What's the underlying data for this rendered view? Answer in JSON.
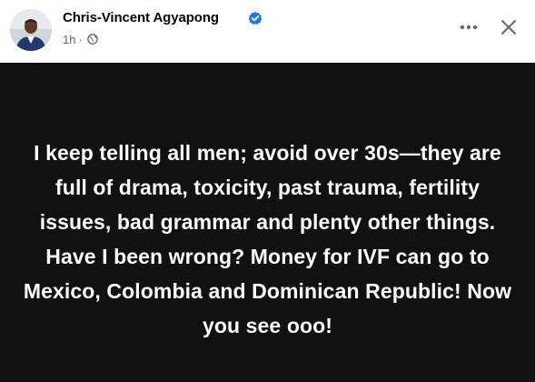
{
  "post": {
    "author": "Chris-Vincent Agyapong",
    "time": "1h",
    "separator": "·",
    "audience_icon": "globe-icon",
    "verified_icon": "verified-badge-icon",
    "text": "I keep telling all men; avoid over 30s—they are full of drama, toxicity, past trauma, fertility issues, bad grammar and plenty other things. Have I been wrong? Money for IVF can go to Mexico, Colombia and Dominican Republic! Now you see ooo!",
    "background_color": "#111111",
    "text_color": "#ffffff"
  },
  "actions": {
    "more_icon": "more-options-icon",
    "close_icon": "close-icon"
  },
  "colors": {
    "verified": "#1877f2",
    "secondary_text": "#65676b",
    "primary_text": "#050505"
  }
}
